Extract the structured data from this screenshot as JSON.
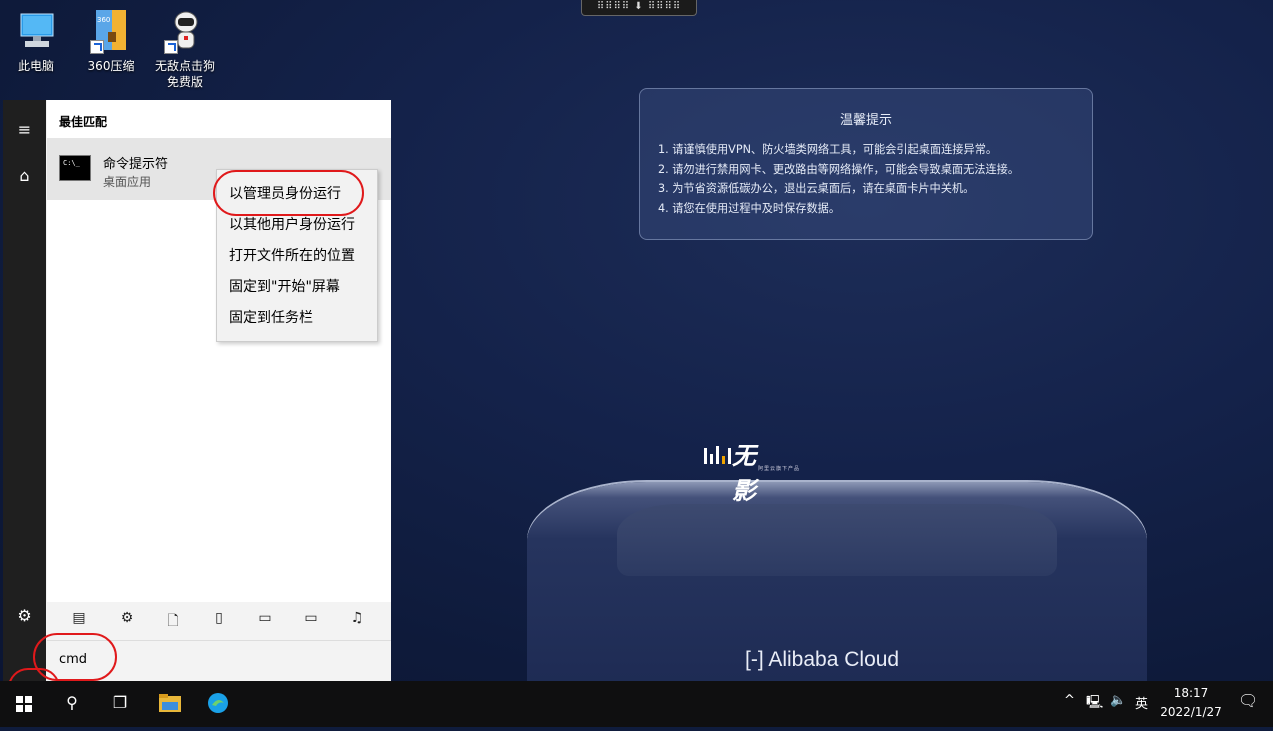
{
  "remote_bar": {
    "label": "⠿⠿⠿⠿ ⬇ ⠿⠿⠿⠿"
  },
  "desktop_icons": [
    {
      "label": "此电脑",
      "icon": "computer-icon"
    },
    {
      "label": "360压缩",
      "icon": "zip-archive-icon"
    },
    {
      "label": "无敌点击狗\n免费版",
      "icon": "robot-app-icon"
    }
  ],
  "notice": {
    "title": "温馨提示",
    "lines": [
      "1. 请谨慎使用VPN、防火墙类网络工具，可能会引起桌面连接异常。",
      "2. 请勿进行禁用网卡、更改路由等网络操作，可能会导致桌面无法连接。",
      "3. 为节省资源低碳办公，退出云桌面后，请在桌面卡片中关机。",
      "4. 请您在使用过程中及时保存数据。"
    ]
  },
  "brand": {
    "name": "无影",
    "subtitle": "阿里云旗下产品",
    "footer": "Alibaba Cloud"
  },
  "start_menu": {
    "section_title": "最佳匹配",
    "best_match": {
      "name": "命令提示符",
      "type": "桌面应用",
      "icon_text": "C:\\_"
    },
    "filters": [
      "apps-filter-icon",
      "settings-filter-icon",
      "documents-filter-icon",
      "devices-filter-icon",
      "photos-filter-icon",
      "videos-filter-icon",
      "music-filter-icon"
    ],
    "search_query": "cmd"
  },
  "context_menu": {
    "items": [
      "以管理员身份运行",
      "以其他用户身份运行",
      "打开文件所在的位置",
      "固定到\"开始\"屏幕",
      "固定到任务栏"
    ]
  },
  "taskbar": {
    "buttons": [
      "start-icon",
      "search-icon",
      "task-view-icon",
      "file-explorer-icon",
      "edge-icon"
    ],
    "tray": {
      "chevron": "^",
      "ime": "英"
    },
    "clock": {
      "time": "18:17",
      "date": "2022/1/27"
    }
  },
  "colors": {
    "annotation": "#e0191b",
    "desktop_bg": "#14224a",
    "taskbar_bg": "#0f0f10"
  }
}
